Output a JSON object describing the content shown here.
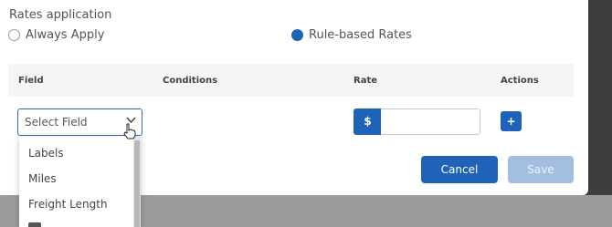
{
  "rates_application": {
    "title": "Rates application",
    "options": [
      {
        "label": "Always Apply",
        "selected": false
      },
      {
        "label": "Rule-based Rates",
        "selected": true
      }
    ]
  },
  "table": {
    "headers": [
      "Field",
      "Conditions",
      "Rate",
      "Actions"
    ],
    "row": {
      "field_select": {
        "placeholder": "Select Field"
      },
      "rate_prefix": "$",
      "rate_value": "",
      "add_label": "+"
    }
  },
  "dropdown": {
    "items": [
      "Labels",
      "Miles",
      "Freight Length"
    ]
  },
  "footer": {
    "cancel_label": "Cancel",
    "save_label": "Save"
  },
  "colors": {
    "primary": "#1f63b8",
    "primary_disabled": "#a3bedf",
    "header_bg": "#f5f5f5"
  }
}
